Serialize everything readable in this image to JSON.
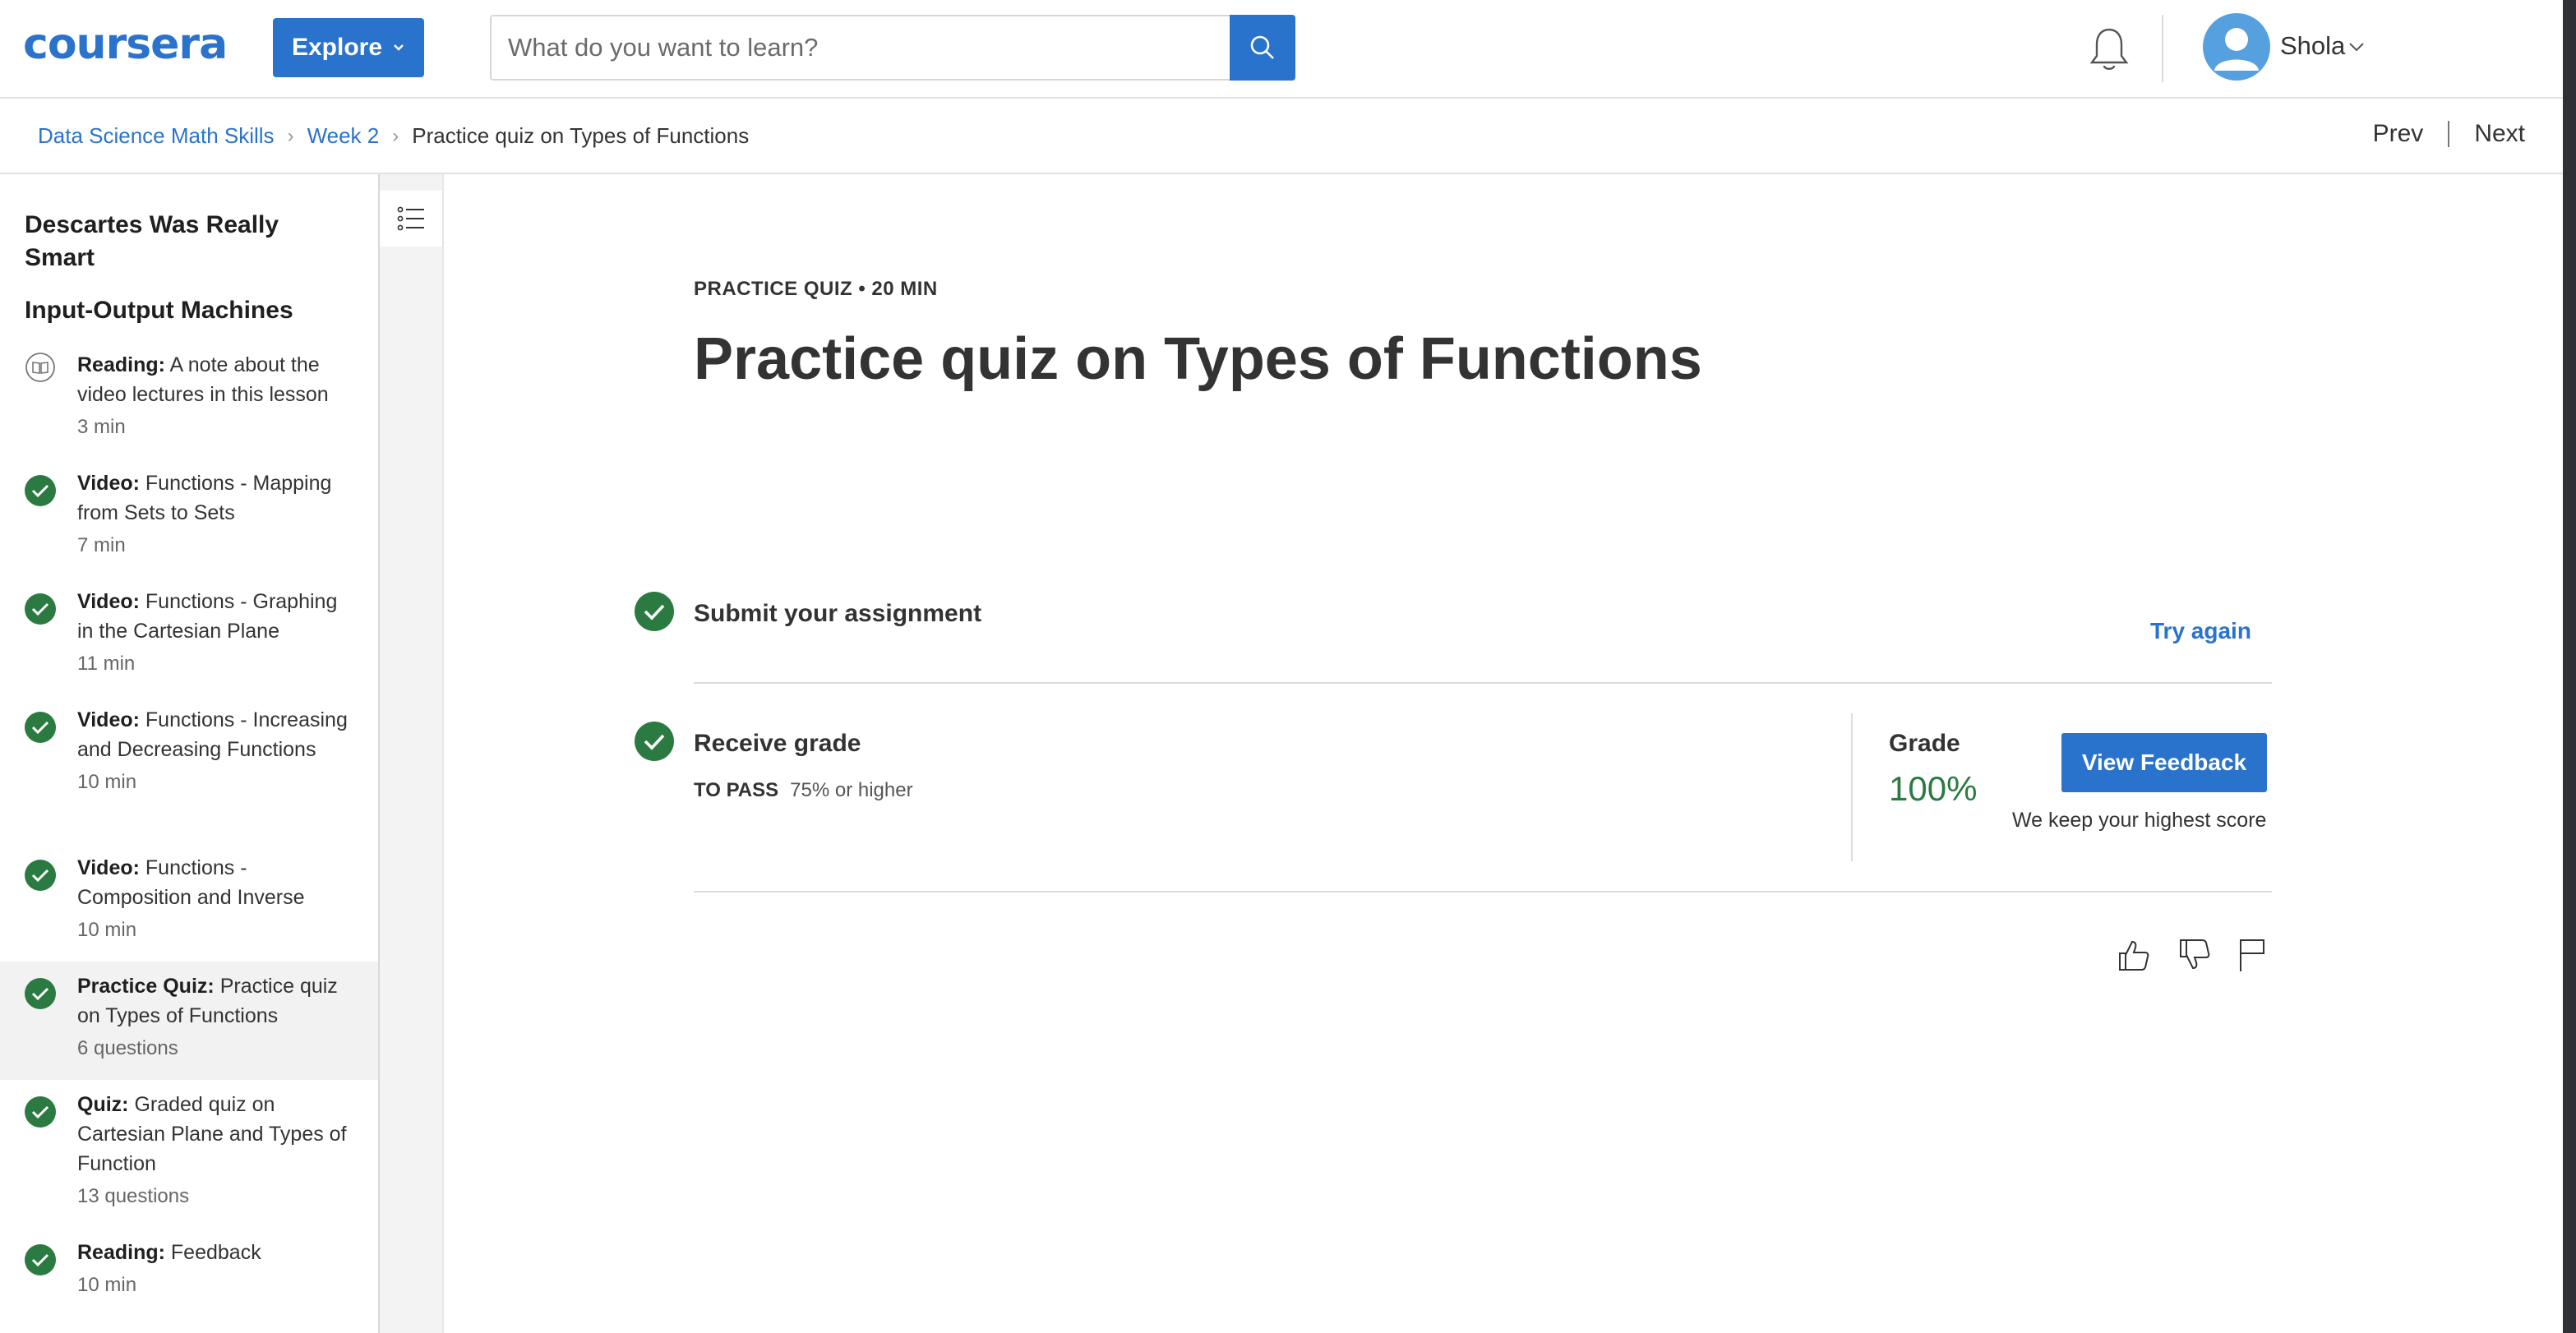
{
  "header": {
    "logo_text": "coursera",
    "explore_label": "Explore",
    "search_placeholder": "What do you want to learn?",
    "user_name": "Shola",
    "brand_color": "#2a73cc"
  },
  "breadcrumb": {
    "items": [
      "Data Science Math Skills",
      "Week 2"
    ],
    "current": "Practice quiz on Types of Functions",
    "prev_label": "Prev",
    "next_label": "Next"
  },
  "sidebar": {
    "lesson_title": "Descartes Was Really Smart",
    "module_title": "Input-Output Machines",
    "items": [
      {
        "type": "Reading:",
        "title": "A note about the video lectures in this lesson",
        "meta": "3 min",
        "status": "book-icon"
      },
      {
        "type": "Video:",
        "title": "Functions - Mapping from Sets to Sets",
        "meta": "7 min",
        "status": "completed"
      },
      {
        "type": "Video:",
        "title": "Functions - Graphing in the Cartesian Plane",
        "meta": "11 min",
        "status": "completed"
      },
      {
        "type": "Video:",
        "title": "Functions - Increasing and Decreasing Functions",
        "meta": "10 min",
        "status": "completed"
      },
      {
        "type": "Video:",
        "title": "Functions - Composition and Inverse",
        "meta": "10 min",
        "status": "completed"
      },
      {
        "type": "Practice Quiz:",
        "title": "Practice quiz on Types of Functions",
        "meta": "6 questions",
        "status": "completed",
        "active": true
      },
      {
        "type": "Quiz:",
        "title": "Graded quiz on Cartesian Plane and Types of Function",
        "meta": "13 questions",
        "status": "completed"
      },
      {
        "type": "Reading:",
        "title": "Feedback",
        "meta": "10 min",
        "status": "completed"
      }
    ]
  },
  "main": {
    "kicker": "PRACTICE QUIZ • 20 MIN",
    "title": "Practice quiz on Types of Functions",
    "submit_label": "Submit your assignment",
    "try_again_label": "Try again",
    "receive_grade_label": "Receive grade",
    "to_pass_label": "TO PASS",
    "to_pass_value": "75% or higher",
    "grade_label": "Grade",
    "grade_value": "100%",
    "view_feedback_label": "View Feedback",
    "keep_highest": "We keep your highest score",
    "success_color": "#2a7a41"
  }
}
